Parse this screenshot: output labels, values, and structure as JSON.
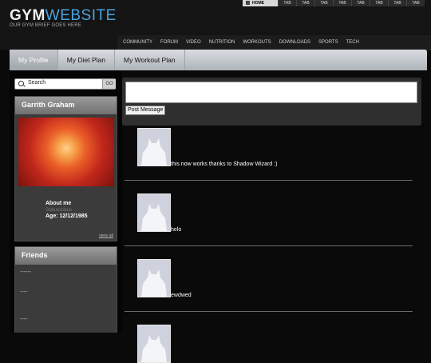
{
  "logo": {
    "main": "GYM",
    "accent": "WEBSITE",
    "tagline": "OUR GYM BRIEF GOES HERE"
  },
  "top_tabs": [
    "HOME",
    "TAB",
    "TAB",
    "TAB",
    "TAB",
    "TAB",
    "TAB",
    "TAB",
    "TAB"
  ],
  "main_nav": [
    "COMMUNITY",
    "FORUM",
    "VIDEO",
    "NUTRITION",
    "WORKOUTS",
    "DOWNLOADS",
    "SPORTS",
    "TECH"
  ],
  "page_tabs": [
    "My Profile",
    "My Diet Plan",
    "My Workout Plan"
  ],
  "search": {
    "placeholder": "Search",
    "go_label": "GO"
  },
  "profile": {
    "name": "Garrith Graham",
    "about_label": "About me",
    "status": "Statusstatus",
    "age": "Age: 12/12/1985",
    "view_all": "view all"
  },
  "friends": {
    "title": "Friends",
    "items": [
      "------",
      "----",
      "----"
    ]
  },
  "post_form": {
    "button_label": "Post Message"
  },
  "posts": [
    {
      "text": "this now works thanks to Shadow Wizard :)"
    },
    {
      "text": "helo"
    },
    {
      "text": "ewdwed"
    },
    {
      "text": ""
    }
  ],
  "colors": {
    "background": "#0a0a0a",
    "accent": "#4aa3df",
    "tab_bar": "#c5c9cd"
  }
}
